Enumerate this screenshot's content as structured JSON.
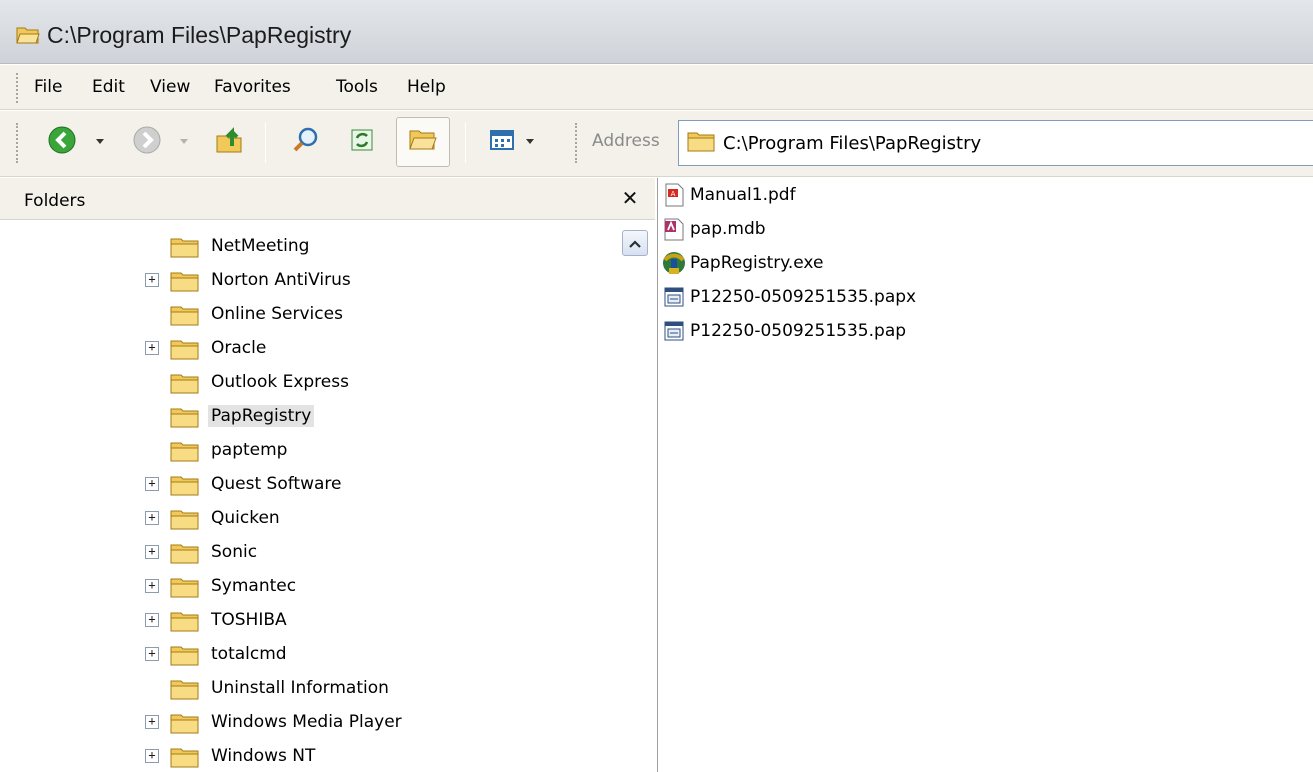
{
  "window": {
    "title": "C:\\Program Files\\PapRegistry"
  },
  "menu": [
    "File",
    "Edit",
    "View",
    "Favorites",
    "Tools",
    "Help"
  ],
  "toolbar": {
    "buttons": [
      "back-icon",
      "forward-icon",
      "up-folder-icon",
      "search-icon",
      "sync-icon",
      "folders-icon",
      "views-icon"
    ]
  },
  "address": {
    "label": "Address",
    "value": "C:\\Program Files\\PapRegistry"
  },
  "folders_pane": {
    "header": "Folders",
    "close_glyph": "✕",
    "items": [
      {
        "label": "NetMeeting",
        "expandable": false,
        "selected": false
      },
      {
        "label": "Norton AntiVirus",
        "expandable": true,
        "selected": false
      },
      {
        "label": "Online Services",
        "expandable": false,
        "selected": false
      },
      {
        "label": "Oracle",
        "expandable": true,
        "selected": false
      },
      {
        "label": "Outlook Express",
        "expandable": false,
        "selected": false
      },
      {
        "label": "PapRegistry",
        "expandable": false,
        "selected": true
      },
      {
        "label": "paptemp",
        "expandable": false,
        "selected": false
      },
      {
        "label": "Quest Software",
        "expandable": true,
        "selected": false
      },
      {
        "label": "Quicken",
        "expandable": true,
        "selected": false
      },
      {
        "label": "Sonic",
        "expandable": true,
        "selected": false
      },
      {
        "label": "Symantec",
        "expandable": true,
        "selected": false
      },
      {
        "label": "TOSHIBA",
        "expandable": true,
        "selected": false
      },
      {
        "label": "totalcmd",
        "expandable": true,
        "selected": false
      },
      {
        "label": "Uninstall Information",
        "expandable": false,
        "selected": false
      },
      {
        "label": "Windows Media Player",
        "expandable": true,
        "selected": false
      },
      {
        "label": "Windows NT",
        "expandable": true,
        "selected": false
      }
    ]
  },
  "files": [
    {
      "name": "Manual1.pdf",
      "icon": "pdf-file-icon"
    },
    {
      "name": "pap.mdb",
      "icon": "access-database-icon"
    },
    {
      "name": "PapRegistry.exe",
      "icon": "application-exe-icon"
    },
    {
      "name": "P12250-0509251535.papx",
      "icon": "generic-file-icon"
    },
    {
      "name": "P12250-0509251535.pap",
      "icon": "generic-file-icon"
    }
  ],
  "colors": {
    "accent_folder": "#f5d36b",
    "selection": "#e3e3e3",
    "address_border": "#7f9db9"
  }
}
